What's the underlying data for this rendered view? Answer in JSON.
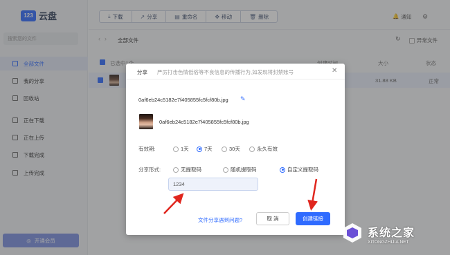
{
  "app": {
    "logo_mark": "123",
    "logo_text": "云盘"
  },
  "sidebar": {
    "search_placeholder": "搜索您的文件",
    "items": [
      {
        "label": "全部文件",
        "icon": "folder-icon",
        "active": true
      },
      {
        "label": "我的分享",
        "icon": "share-icon"
      },
      {
        "label": "回收站",
        "icon": "trash-icon"
      },
      {
        "label": "正在下载",
        "icon": "download-icon"
      },
      {
        "label": "正在上传",
        "icon": "upload-icon"
      },
      {
        "label": "下载完成",
        "icon": "download-done-icon"
      },
      {
        "label": "上传完成",
        "icon": "upload-done-icon"
      }
    ],
    "vip_label": "开通会员"
  },
  "toolbar": {
    "download": "下载",
    "share": "分享",
    "rename": "重命名",
    "move": "移动",
    "delete": "删除",
    "notify": "通知"
  },
  "breadcrumb": {
    "current": "全部文件"
  },
  "abnormal_files": "异常文件",
  "file_list": {
    "selected_count": "已选中1个",
    "col_created": "创建时间",
    "col_size": "大小",
    "col_status": "状态",
    "rows": [
      {
        "size": "31.88 KB",
        "status": "正常"
      }
    ]
  },
  "share_dialog": {
    "title": "分享",
    "warning": "严厉打击色情低俗等不良信息的传播行为,如发现将封禁账号",
    "filename": "0af6eb24c5182e7f405855fc5fcf80b.jpg",
    "thumb_filename": "0af6eb24c5182e7f405855fc5fcf80b.jpg",
    "validity_label": "有效期:",
    "validity_options": [
      "1天",
      "7天",
      "30天",
      "永久有效"
    ],
    "validity_selected": "7天",
    "share_form_label": "分享形式:",
    "share_form_options": [
      "无提取码",
      "随机提取码",
      "自定义提取码"
    ],
    "share_form_selected": "自定义提取码",
    "code_value": "1234",
    "help_link": "文件分享遇到问题?",
    "cancel_label": "取 消",
    "create_label": "创建链接"
  },
  "watermark": {
    "title": "系统之家",
    "url": "XITONGZHIJIA.NET"
  },
  "colors": {
    "accent": "#2f6bff",
    "annotation_arrow": "#e0261e"
  }
}
